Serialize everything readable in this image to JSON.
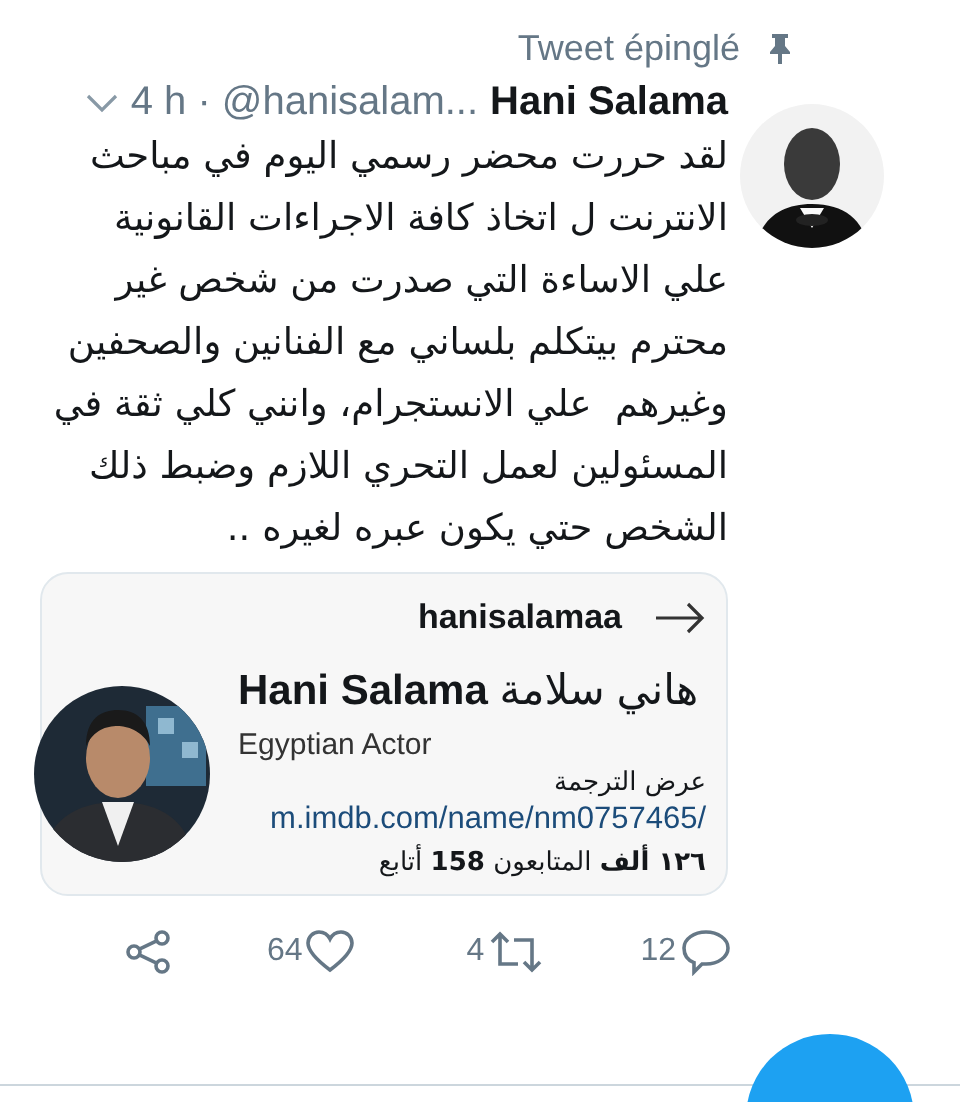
{
  "pinned": {
    "label": "Tweet épinglé"
  },
  "tweet": {
    "author_name": "Hani Salama",
    "meta": "4 h · @hanisalam...",
    "text": "لقد حررت محضر رسمي اليوم في مباحث\nالانترنت ل اتخاذ كافة الاجراءات القانونية\nعلي الاساءة التي صدرت من شخص غير\nمحترم بيتكلم بلساني مع الفنانين والصحفين\nوغيرهم  علي الانستجرام، وانني كلي ثقة في\nالمسئولين لعمل التحري اللازم وضبط ذلك\nالشخص حتي يكون عبره لغيره .."
  },
  "card": {
    "username": "hanisalamaa",
    "name": "**Hani Salama** هاني سلامة",
    "bio": "Egyptian Actor",
    "translate": "عرض الترجمة",
    "url": "m.imdb.com/name/nm0757465/",
    "stats": "**١٢٦ ألف** المتابعون **158** أتابع"
  },
  "actions": [
    {
      "kind": "reply",
      "count": "12"
    },
    {
      "kind": "retweet",
      "count": "4"
    },
    {
      "kind": "like",
      "count": "64"
    },
    {
      "kind": "share"
    }
  ]
}
